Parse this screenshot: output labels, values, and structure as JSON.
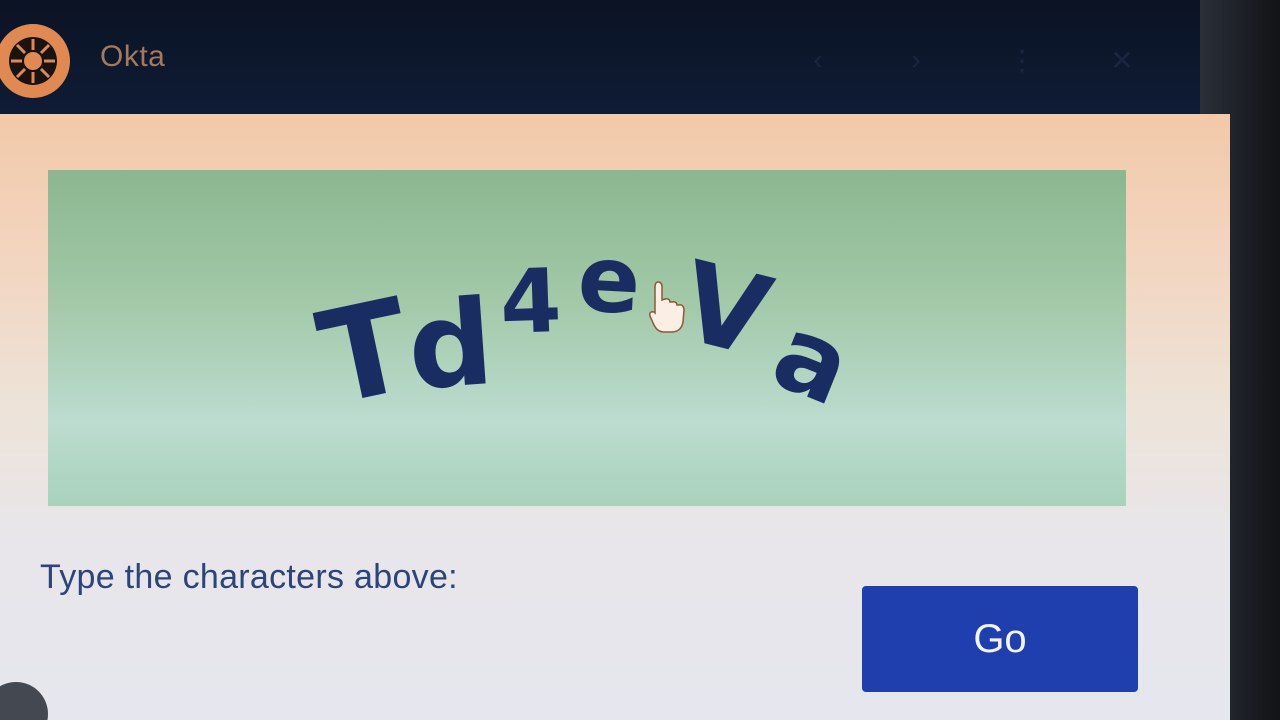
{
  "window": {
    "title": "Okta",
    "app_icon": "okta-sunburst-icon",
    "controls": [
      "back-arrow-icon",
      "forward-arrow-icon",
      "more-vert-icon",
      "close-icon"
    ]
  },
  "captcha": {
    "characters": [
      "T",
      "d",
      "4",
      "e",
      "V",
      "a"
    ],
    "text_color": "#1a2d63"
  },
  "form": {
    "prompt": "Type the characters above:",
    "input_value": "",
    "submit_label": "Go",
    "submit_color": "#1f3fae"
  }
}
